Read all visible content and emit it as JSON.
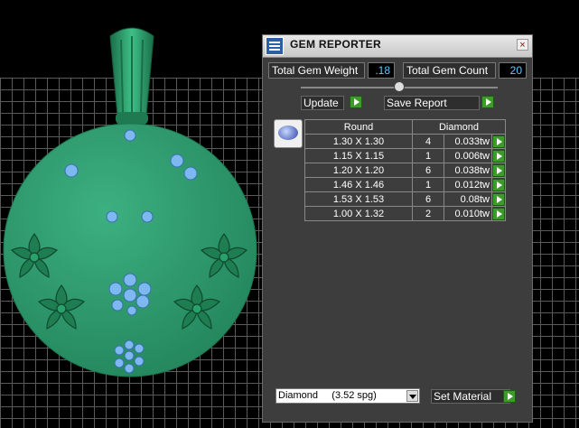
{
  "viewport": {
    "background": "#000000",
    "grid_color": "#5a5a5a",
    "pendant_color": "#2e9a6e",
    "gem_color": "#7db8f0"
  },
  "panel": {
    "title": "GEM REPORTER",
    "close_label": "×",
    "total_weight_label": "Total Gem Weight",
    "total_weight_value": ".18",
    "total_count_label": "Total Gem Count",
    "total_count_value": "20",
    "update_label": "Update",
    "save_report_label": "Save Report",
    "table": {
      "shape_header": "Round",
      "material_header": "Diamond",
      "rows": [
        {
          "size": "1.30 X 1.30",
          "qty": "4",
          "tw": "0.033tw"
        },
        {
          "size": "1.15 X 1.15",
          "qty": "1",
          "tw": "0.006tw"
        },
        {
          "size": "1.20 X 1.20",
          "qty": "6",
          "tw": "0.038tw"
        },
        {
          "size": "1.46 X 1.46",
          "qty": "1",
          "tw": "0.012tw"
        },
        {
          "size": "1.53 X 1.53",
          "qty": "6",
          "tw": "0.08tw"
        },
        {
          "size": "1.00 X 1.32",
          "qty": "2",
          "tw": "0.010tw"
        }
      ]
    },
    "material_select": "Diamond     (3.52 spg)",
    "set_material_label": "Set Material",
    "accent_green": "#3c9c2a"
  }
}
